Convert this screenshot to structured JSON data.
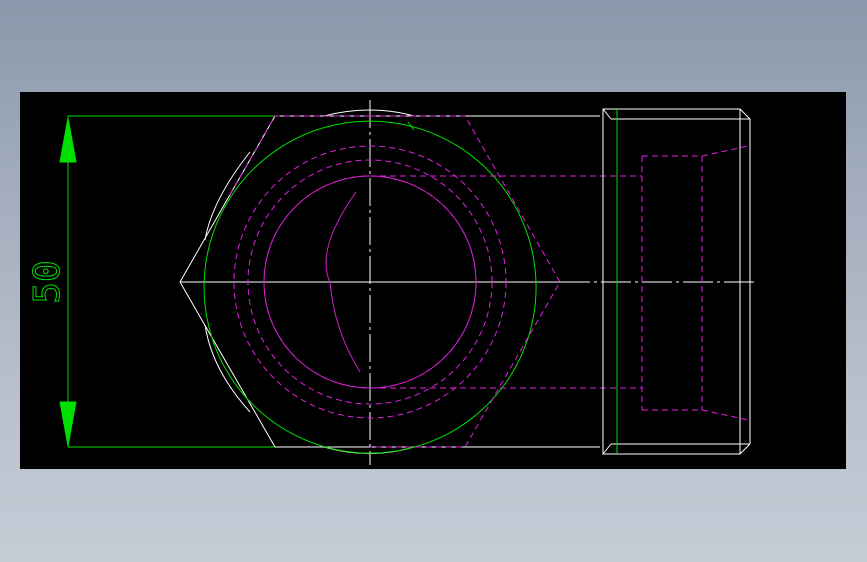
{
  "drawing": {
    "colors": {
      "background": "#000000",
      "outline": "#ffffff",
      "dimension": "#00e000",
      "hidden": "#e020e0",
      "arc": "#d020d0"
    },
    "dimension": {
      "value": "50"
    }
  }
}
